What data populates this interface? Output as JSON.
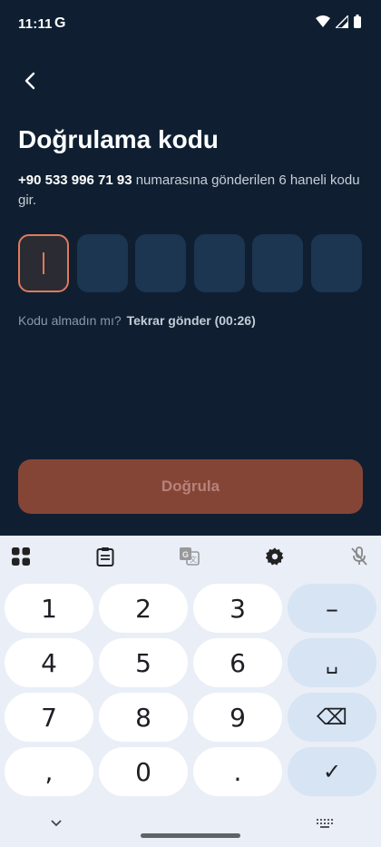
{
  "status_bar": {
    "time": "11:11",
    "g_label": "G"
  },
  "page": {
    "title": "Doğrulama kodu",
    "phone": "+90 533 996 71 93",
    "description_rest": " numarasına gönderilen 6 haneli kodu gir.",
    "otp_count": 6,
    "resend_prompt": "Kodu almadın mı?",
    "resend_action": "Tekrar gönder (00:26)",
    "verify_label": "Doğrula"
  },
  "keyboard": {
    "rows": [
      [
        "1",
        "2",
        "3",
        "–"
      ],
      [
        "4",
        "5",
        "6",
        "␣"
      ],
      [
        "7",
        "8",
        "9",
        "⌫"
      ],
      [
        ",",
        "0",
        ".",
        "✓"
      ]
    ]
  },
  "colors": {
    "accent": "#e07a5a",
    "background": "#0f1f31",
    "box": "#1c3550",
    "button": "#854536"
  }
}
